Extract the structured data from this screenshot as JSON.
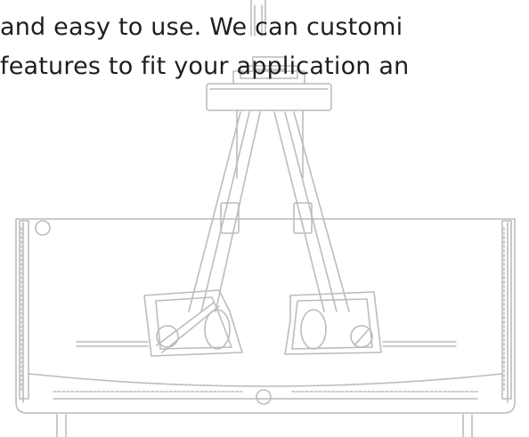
{
  "document": {
    "text_lines": [
      "and easy to use.  We can customi",
      "features to fit your application an"
    ],
    "top_partial_line": "",
    "line_color": "#b8b8b8"
  }
}
